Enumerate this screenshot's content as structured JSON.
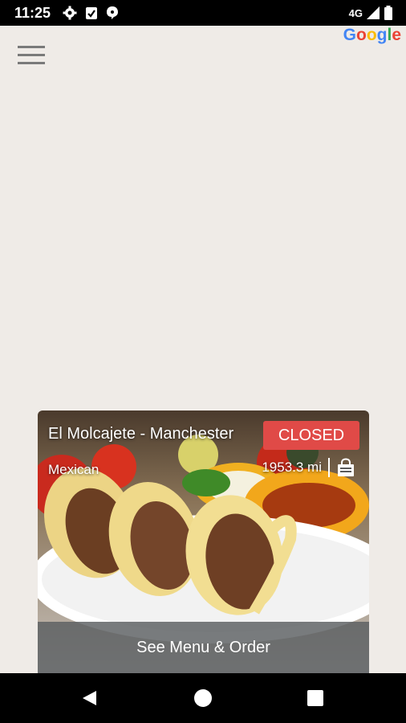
{
  "status_bar": {
    "time": "11:25",
    "network": "4G",
    "icons": [
      "settings-icon",
      "clipboard-icon",
      "message-icon",
      "signal-icon",
      "battery-icon"
    ]
  },
  "map": {
    "attribution": {
      "g1": "G",
      "o1": "o",
      "o2": "o",
      "g2": "g",
      "l": "l",
      "e": "e"
    }
  },
  "restaurant": {
    "name": "El Molcajete - Manchester",
    "status": "CLOSED",
    "cuisine": "Mexican",
    "distance": "1953.3 mi",
    "order_label": "See Menu & Order",
    "status_color": "#e04a47"
  },
  "navigation": {
    "icons": [
      "back-icon",
      "home-icon",
      "recents-icon"
    ]
  }
}
